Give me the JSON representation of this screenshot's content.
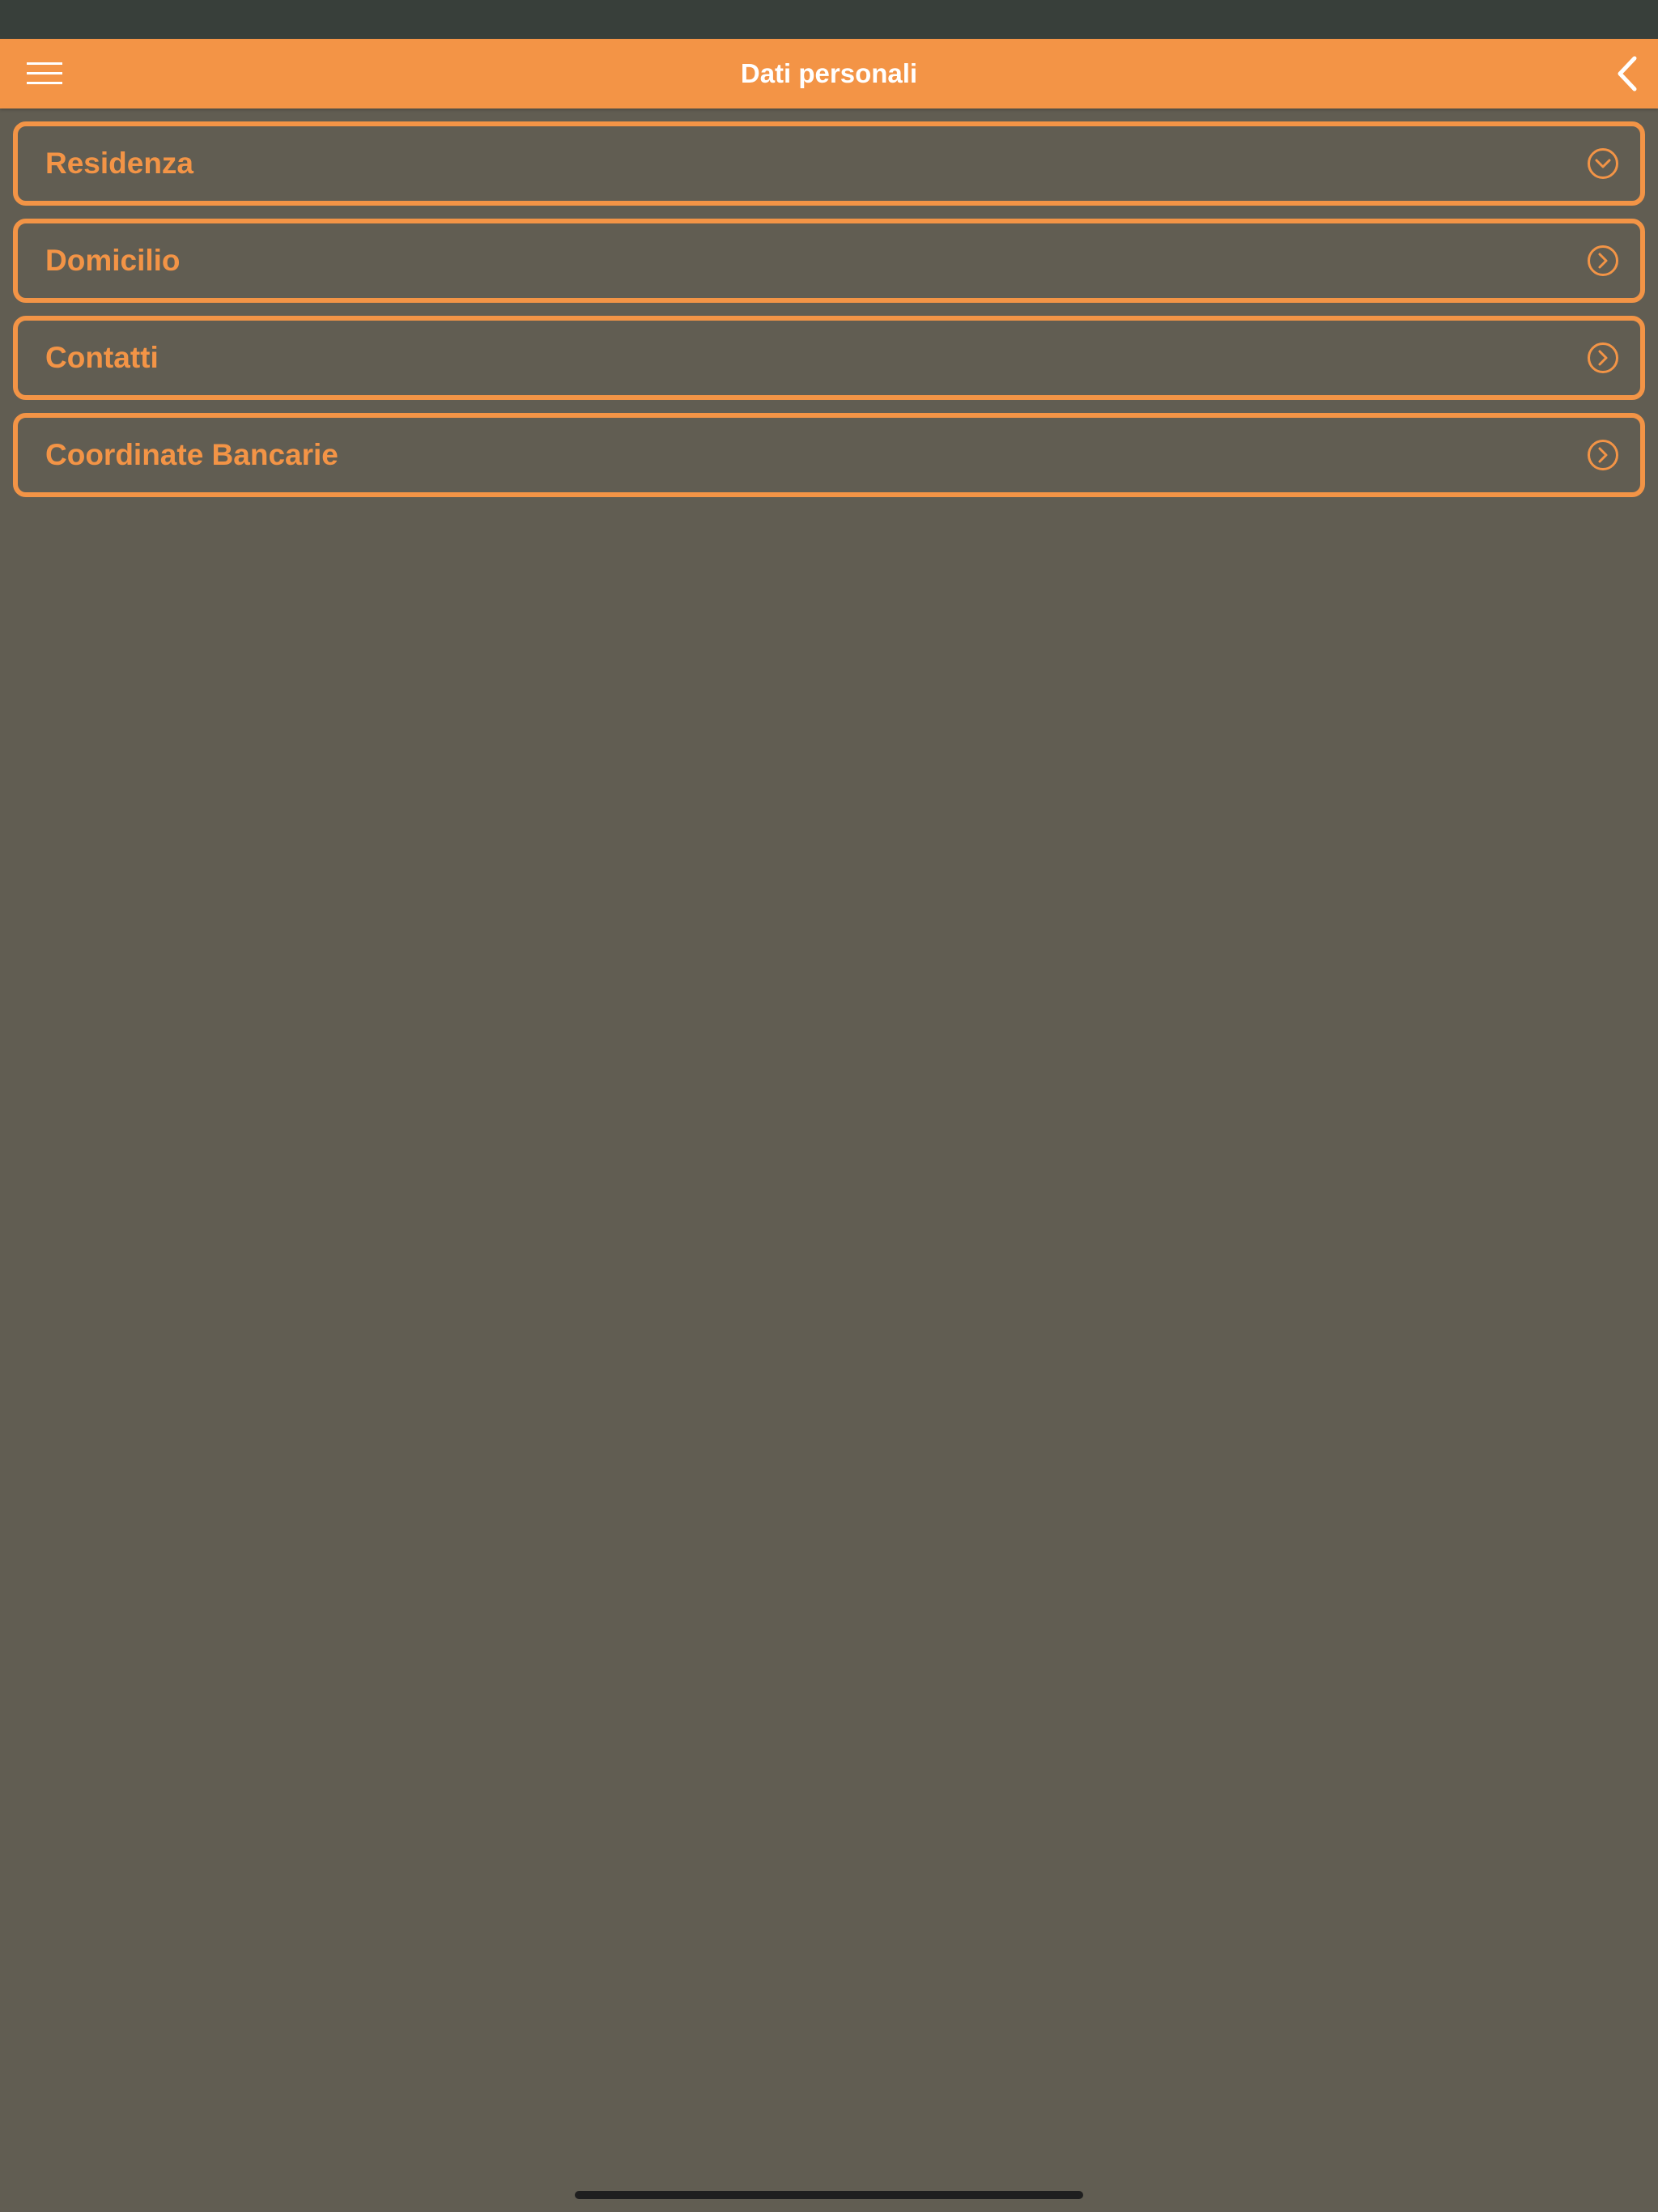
{
  "header": {
    "title": "Dati personali",
    "menu_icon": "hamburger-menu-icon",
    "back_icon": "chevron-left-icon"
  },
  "sections": [
    {
      "label": "Residenza",
      "icon": "chevron-down-circle-icon",
      "expanded": true
    },
    {
      "label": "Domicilio",
      "icon": "chevron-right-circle-icon",
      "expanded": false
    },
    {
      "label": "Contatti",
      "icon": "chevron-right-circle-icon",
      "expanded": false
    },
    {
      "label": "Coordinate Bancarie",
      "icon": "chevron-right-circle-icon",
      "expanded": false
    }
  ],
  "colors": {
    "accent": "#f39446",
    "background": "#615d52",
    "status_bar": "#383f3a",
    "title_text": "#ffffff"
  }
}
